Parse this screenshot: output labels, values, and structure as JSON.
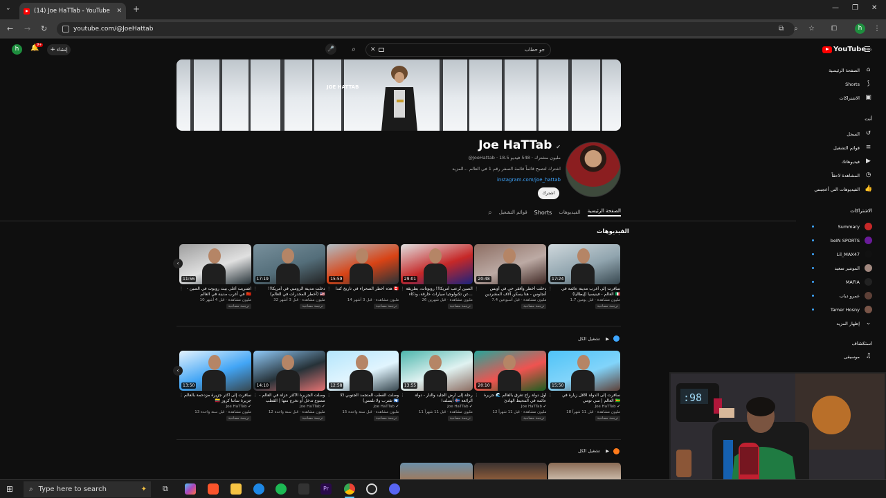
{
  "browser": {
    "tab_title": "(14) Joe HaTTab - YouTube",
    "url": "youtube.com/@JoeHattab",
    "profile_letter": "h"
  },
  "youtube": {
    "search_query": "جو حطاب",
    "create_label": "إنشاء",
    "notif_count": "9+",
    "logo_text": "YouTube",
    "logo_region": "EG"
  },
  "channel": {
    "banner_logo_text": "JOE HATTAB",
    "name": "Joe HaTTab",
    "handle_line": "@JoeHattab · 18.5 مليون مشترك · 548 فيديو",
    "description": "اشترك لتصبح قائماً قائمة السفر رقم 1 في العالم ...المزيد",
    "link": "instagram.com/joe_hattab",
    "subscribe_label": "اشترك",
    "tabs": [
      "الصفحة الرئيسية",
      "الفيديوهات",
      "Shorts",
      "قوائم التشغيل"
    ]
  },
  "sections": {
    "videos_title": "الفيديوهات",
    "playall_label": "تشغيل الكل"
  },
  "row1": [
    {
      "title": "سافرت إلى أغرب مدينة عائمة في العالم - فينيسيا (إيطاليا) 🇮🇹",
      "meta": "1.7 مليون مشاهدة · قبل يومين",
      "duration": "17:24",
      "tag": "ترجمة مصاحبة"
    },
    {
      "title": "دخلت أخطر وأفقر حي في أوبس أنجلوس - هنا يسكن آلاف المشردين Skid Row...",
      "meta": "7.4 مليون مشاهدة · قبل أسبوعين",
      "duration": "20:48",
      "tag": "ترجمة مصاحبة"
    },
    {
      "title": "الصين تُرعب أمريكا!! روبوتات، بطريقة عن تكنولوجيا سيارات خارقة، وذكاء...",
      "meta": "26 مليون مشاهدة · قبل شهرين",
      "duration": "29:01",
      "tag": "ترجمة مصاحبة"
    },
    {
      "title": "هذه أخطر الصحراء في تاريخ كندا 🇨🇦",
      "meta": "14 مليون مشاهدة · قبل 3 أشهر",
      "duration": "15:59",
      "tag": "ترجمة مصاحبة"
    },
    {
      "title": "دخلت مدينة الزومبي في أمريكا!! (أخطر المخدرات في العالم) 🇺🇸",
      "meta": "32 مليون مشاهدة · قبل 3 أشهر",
      "duration": "17:19",
      "tag": "ترجمة مصاحبة"
    },
    {
      "title": "اشتريت أغلى بيت روبوت في الصين - في أغرب مدينة في العالم 🇨🇳",
      "meta": "10 مليون مشاهدة · قبل 4 أشهر",
      "duration": "11:56",
      "tag": "ترجمة مصاحبة"
    }
  ],
  "row2": [
    {
      "title": "سافرت إلى الدولة الأقل زيارة في العالم | سي تومي 🇸🇹",
      "channel": "Joe HaTTab",
      "meta": "18 مليون مشاهدة · قبل 11 شهراً",
      "duration": "15:50",
      "tag": "ترجمة مصاحبة"
    },
    {
      "title": "أول دولة راح تغرق بالعالم 🌊 جزيرة عائمة في المحيط الهادئ",
      "channel": "Joe HaTTab",
      "meta": "12 مليون مشاهدة · قبل 11 شهراً",
      "duration": "20:10",
      "tag": "ترجمة مصاحبة"
    },
    {
      "title": "رحلة إلى أرض الجليد والنار - دولة أيسلندا 🇮🇸 الرائعة",
      "channel": "Joe HaTTab",
      "meta": "11 مليون مشاهدة · قبل 11 شهراً",
      "duration": "13:55",
      "tag": "ترجمة مصاحبة"
    },
    {
      "title": "وصلت القطب المتجمد الجنوبي (لا تقترب ولا تلمس) 🇦🇶",
      "channel": "Joe HaTTab",
      "meta": "15 مليون مشاهدة · قبل سنة واحدة",
      "duration": "12:58",
      "tag": "ترجمة مصاحبة"
    },
    {
      "title": "وصلت الجزيرة الأكثر عزلة في العالم - ممنوع تدخل أو تخرج منها | القطب الشمالي",
      "channel": "Joe HaTTab",
      "meta": "12 مليون مشاهدة · قبل سنة واحدة",
      "duration": "14:10",
      "tag": "ترجمة مصاحبة"
    },
    {
      "title": "سافرت إلى أكثر جزيرة مزدحمة بالعالم 🇨🇴 جزيرة سانتا كروز",
      "channel": "Joe HaTTab",
      "meta": "13 مليون مشاهدة · قبل سنة واحدة",
      "duration": "13:50",
      "tag": "ترجمة مصاحبة"
    }
  ],
  "sidebar": {
    "main": [
      {
        "label": "الصفحة الرئيسية",
        "icon": "home-icon",
        "glyph": "⌂"
      },
      {
        "label": "Shorts",
        "icon": "shorts-icon",
        "glyph": "⟆"
      },
      {
        "label": "الاشتراكات",
        "icon": "subscriptions-icon",
        "glyph": "▣"
      }
    ],
    "you_header": "أنت",
    "you": [
      {
        "label": "السجل",
        "icon": "history-icon",
        "glyph": "↺"
      },
      {
        "label": "قوائم التشغيل",
        "icon": "playlists-icon",
        "glyph": "≡"
      },
      {
        "label": "فيديوهاتك",
        "icon": "your-videos-icon",
        "glyph": "▶"
      },
      {
        "label": "المشاهدة لاحقاً",
        "icon": "watch-later-icon",
        "glyph": "◷"
      },
      {
        "label": "الفيديوهات التي أعجبتني",
        "icon": "liked-icon",
        "glyph": "👍"
      }
    ],
    "subs_header": "الاشتراكات",
    "subs": [
      {
        "label": "Summary",
        "color": "#c62828"
      },
      {
        "label": "beIN SPORTS",
        "color": "#6a1b9a"
      },
      {
        "label": "Lil_MAX47",
        "color": "#111111"
      },
      {
        "label": "المونتير سعيد",
        "color": "#a1887f"
      },
      {
        "label": "MAFIA",
        "color": "#222222"
      },
      {
        "label": "عمرو دياب",
        "color": "#5d4037"
      },
      {
        "label": "Tamer Hosny",
        "color": "#795548"
      }
    ],
    "show_more": "إظهار المزيد",
    "explore_header": "استكشاف",
    "explore": [
      {
        "label": "موسيقى",
        "icon": "music-icon",
        "glyph": "♫"
      }
    ]
  },
  "taskbar": {
    "search_placeholder": "Type here to search"
  }
}
